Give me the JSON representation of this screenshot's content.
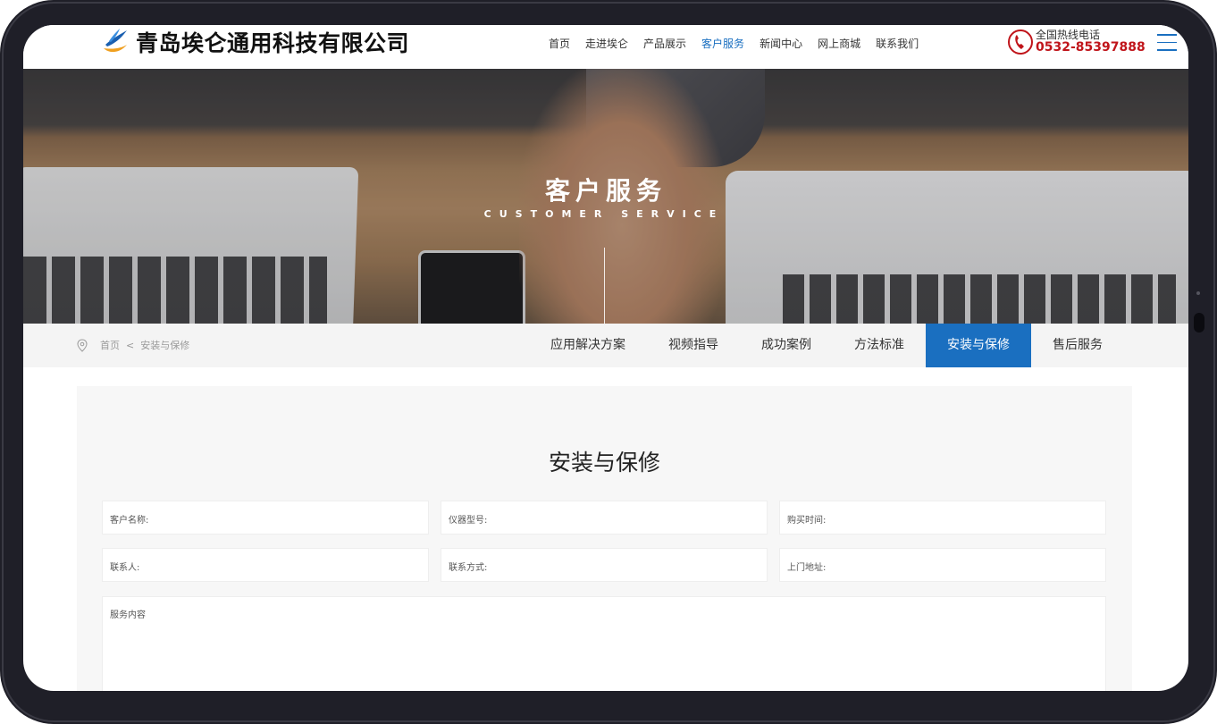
{
  "header": {
    "company_name": "青岛埃仑通用科技有限公司",
    "nav": [
      {
        "label": "首页",
        "active": false
      },
      {
        "label": "走进埃仑",
        "active": false
      },
      {
        "label": "产品展示",
        "active": false
      },
      {
        "label": "客户服务",
        "active": true
      },
      {
        "label": "新闻中心",
        "active": false
      },
      {
        "label": "网上商城",
        "active": false
      },
      {
        "label": "联系我们",
        "active": false
      }
    ],
    "hotline_label": "全国热线电话",
    "hotline_number": "0532-85397888"
  },
  "banner": {
    "title": "客户服务",
    "subtitle": "CUSTOMER SERVICE"
  },
  "breadcrumb": {
    "home": "首页",
    "separator": "<",
    "current": "安装与保修"
  },
  "subtabs": [
    {
      "label": "应用解决方案",
      "active": false
    },
    {
      "label": "视频指导",
      "active": false
    },
    {
      "label": "成功案例",
      "active": false
    },
    {
      "label": "方法标准",
      "active": false
    },
    {
      "label": "安装与保修",
      "active": true
    },
    {
      "label": "售后服务",
      "active": false
    }
  ],
  "form": {
    "title": "安装与保修",
    "fields": {
      "customer_name": "客户名称:",
      "instrument_model": "仪器型号:",
      "purchase_time": "购买时间:",
      "contact_person": "联系人:",
      "contact_method": "联系方式:",
      "address": "上门地址:"
    },
    "service_content": "服务内容"
  },
  "colors": {
    "accent": "#1a6fc0",
    "hotline": "#c0141a",
    "subnav_bg": "#f4f4f4",
    "form_bg": "#f7f7f7"
  },
  "icons": {
    "logo": "bird-logo-icon",
    "phone": "phone-icon",
    "menu": "hamburger-menu-icon",
    "location": "location-pin-icon"
  }
}
